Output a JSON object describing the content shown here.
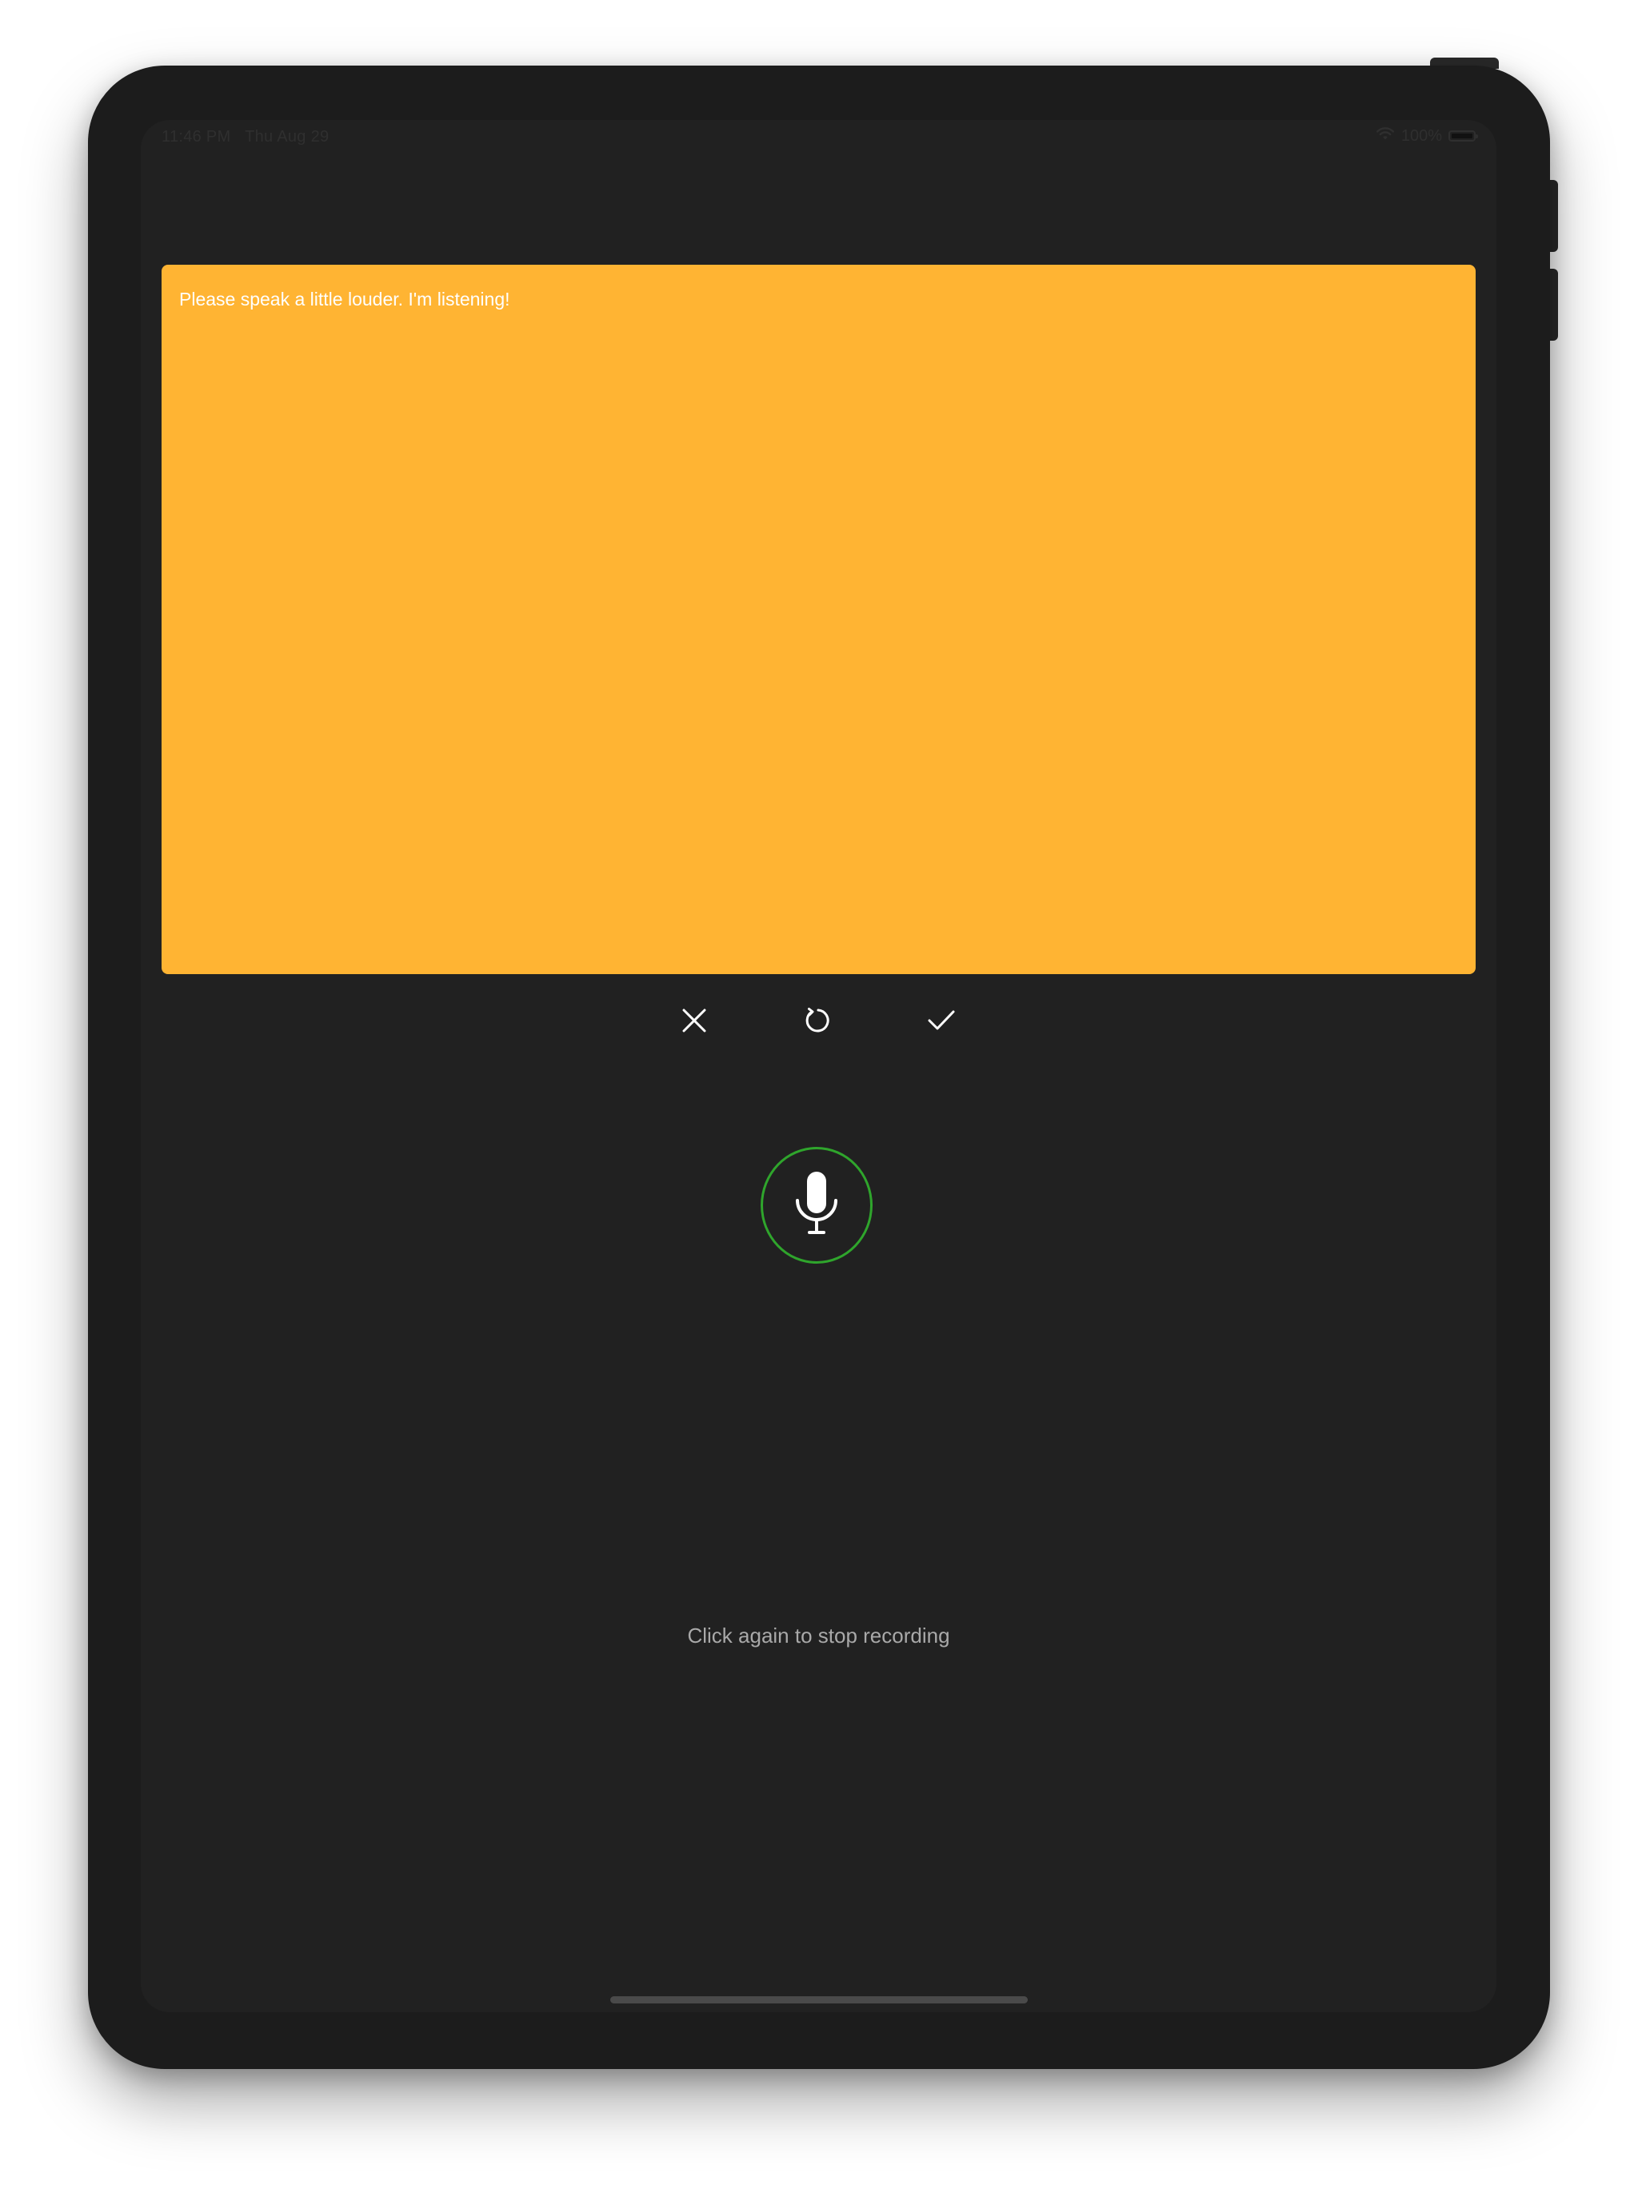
{
  "status_bar": {
    "time": "11:46 PM",
    "date": "Thu Aug 29",
    "battery": "100%",
    "wifi_icon": "wifi-icon",
    "battery_icon": "battery-icon"
  },
  "transcript": {
    "text": "Please speak a little louder. I'm listening!",
    "background_color": "#ffb433"
  },
  "actions": {
    "cancel_icon": "close-icon",
    "retry_icon": "refresh-icon",
    "confirm_icon": "checkmark-icon"
  },
  "mic": {
    "icon": "microphone-icon",
    "state": "recording",
    "ring_color": "#2fa52c"
  },
  "hint": {
    "text": "Click again to stop recording"
  },
  "theme": {
    "screen_background": "#212121",
    "hint_color": "#a9a9a9"
  }
}
